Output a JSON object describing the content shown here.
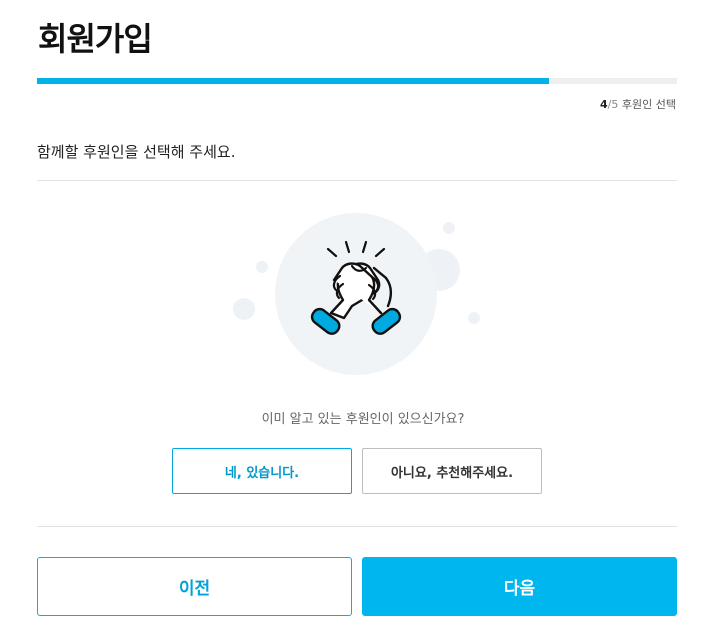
{
  "page": {
    "title": "회원가입"
  },
  "progress": {
    "current": "4",
    "separator": "/",
    "total": "5",
    "step_name": "후원인 선택",
    "percent": 80
  },
  "instruction": "함께할 후원인을 선택해 주세요.",
  "illustration": {
    "icon": "handshake-icon",
    "accent_color": "#00a9e0"
  },
  "question": "이미 알고 있는 후원인이 있으신가요?",
  "choices": {
    "yes_label": "네, 있습니다.",
    "no_label": "아니요, 추천해주세요."
  },
  "nav": {
    "prev_label": "이전",
    "next_label": "다음"
  },
  "colors": {
    "primary": "#00b6ee",
    "border_neutral": "#bdbdbd"
  }
}
